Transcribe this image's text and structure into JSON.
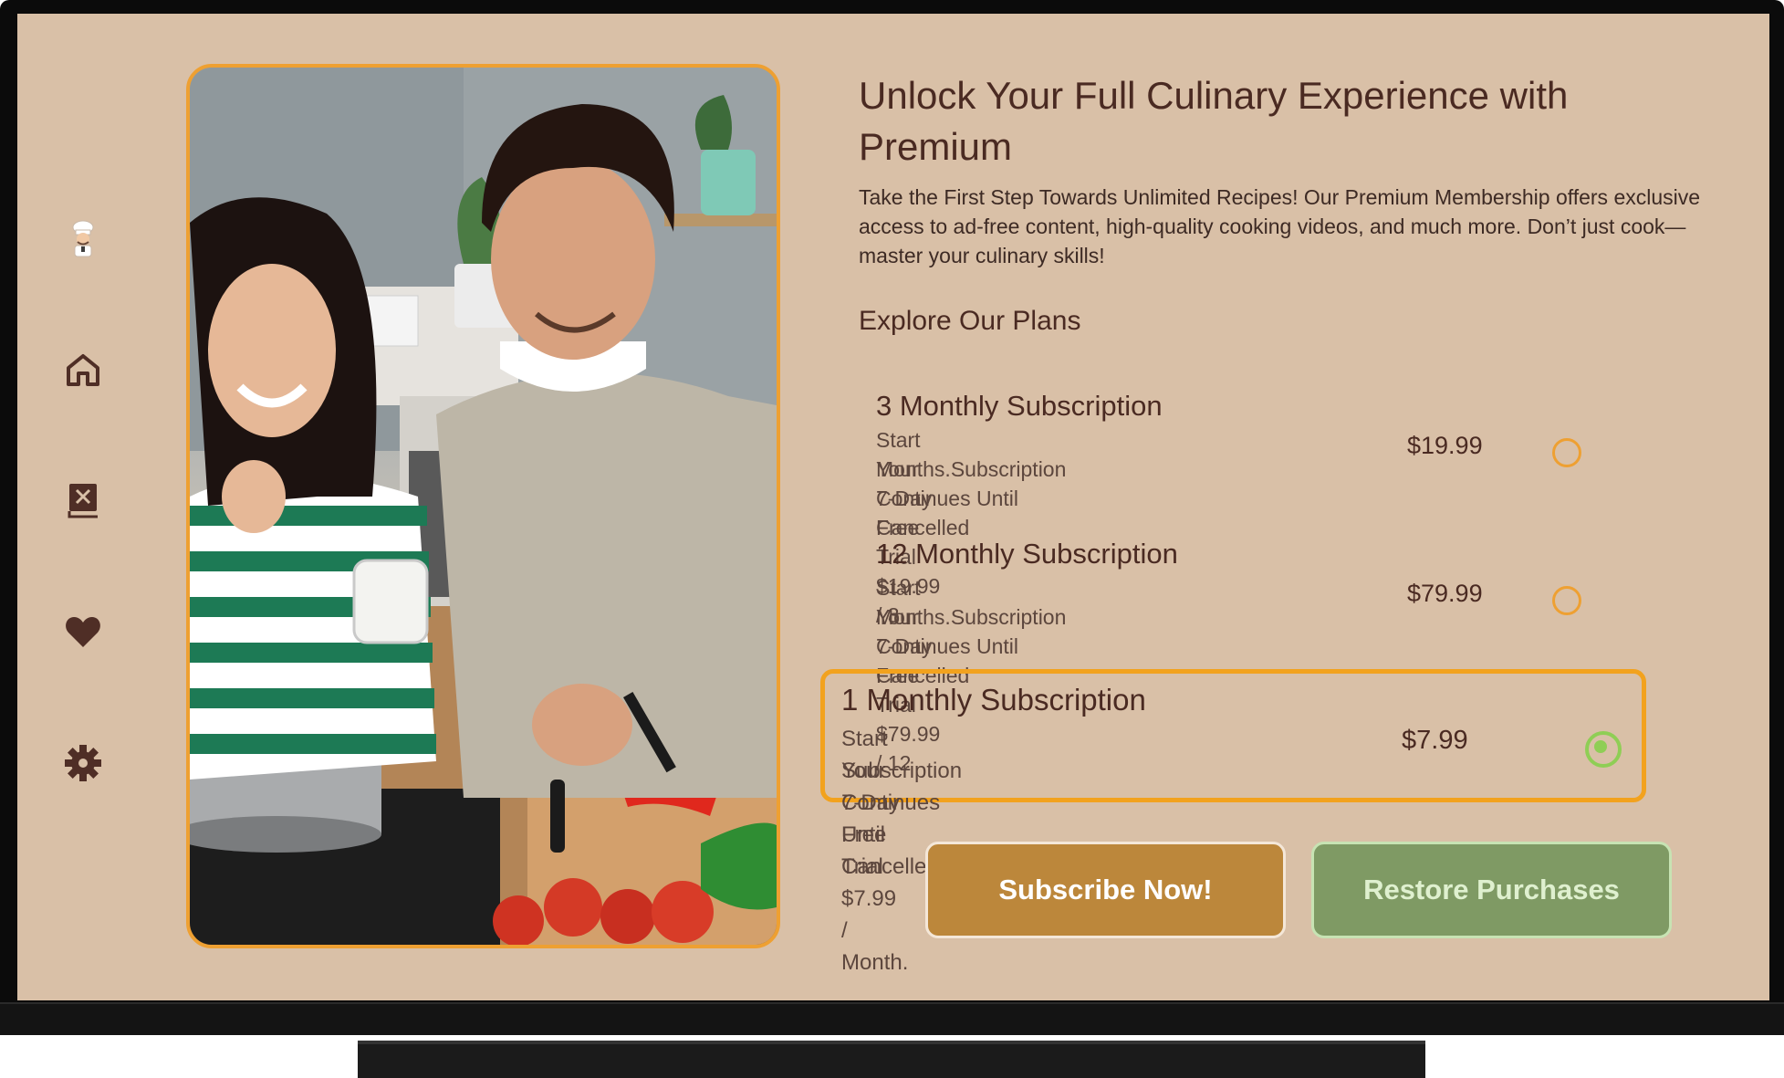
{
  "nav": {
    "items": [
      {
        "name": "chef-avatar",
        "icon": "chef-icon"
      },
      {
        "name": "home",
        "icon": "home-icon"
      },
      {
        "name": "recipes",
        "icon": "recipe-book-icon"
      },
      {
        "name": "favorites",
        "icon": "heart-icon"
      },
      {
        "name": "settings",
        "icon": "gear-icon"
      }
    ]
  },
  "hero_image": {
    "alt": "Couple cooking together in a kitchen"
  },
  "header": {
    "title": "Unlock Your Full Culinary Experience with Premium",
    "description": "Take the First Step Towards Unlimited Recipes! Our Premium Membership offers exclusive access to ad-free content, high-quality cooking videos, and much more. Don’t just cook—master your culinary skills!"
  },
  "plans_section": {
    "heading": "Explore Our Plans",
    "plans": [
      {
        "name": "3 Monthly Subscription",
        "desc_line1": "Start Your 7-Day Free Trial $19.99 / 3",
        "desc_line2": "Months.Subscription Continues Until Cancelled",
        "price": "$19.99",
        "selected": false
      },
      {
        "name": "12 Monthly Subscription",
        "desc_line1": "Start Your 7-Day Free Trial $79.99 / 12",
        "desc_line2": "Months.Subscription Continues Until Cancelled",
        "price": "$79.99",
        "selected": false
      },
      {
        "name": "1 Monthly Subscription",
        "desc_line1": "Start Your 7-Day Free Trial $7.99 / Month.",
        "desc_line2": "Subscription Continues Until Cancelled",
        "price": "$7.99",
        "selected": true
      }
    ]
  },
  "actions": {
    "subscribe_label": "Subscribe Now!",
    "restore_label": "Restore Purchases"
  },
  "colors": {
    "background": "#d9c0a7",
    "accent": "#eea032",
    "selected": "#8fce55",
    "text": "#4a2a22"
  }
}
